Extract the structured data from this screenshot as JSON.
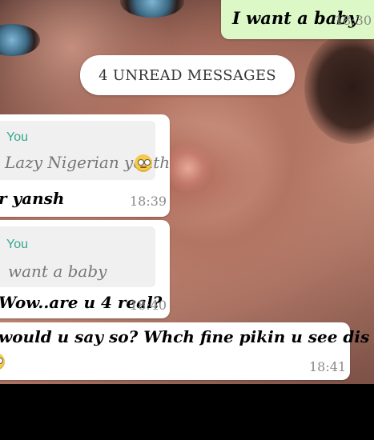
{
  "chat": {
    "outgoing_top": {
      "text": "I want a baby",
      "time": "18:30"
    },
    "unread_banner": "4 UNREAD MESSAGES",
    "messages": [
      {
        "quote_sender": "You",
        "quote_text": "Lazy Nigerian youth",
        "quote_emoji": "face-with-rolling-eyes",
        "text": "r yansh",
        "time": "18:39"
      },
      {
        "quote_sender": "You",
        "quote_text": "want a baby",
        "text": "Wow..are u 4 real?",
        "time": "18:40"
      },
      {
        "text": "would u say so? Whch fine pikin u see dis evening",
        "emoji": "thinking-face",
        "time": "18:41"
      }
    ]
  },
  "colors": {
    "outgoing_bubble": "#dcf8c6",
    "incoming_bubble": "#ffffff",
    "quote_accent": "#35a88e",
    "bottom_bar": "#000000"
  }
}
